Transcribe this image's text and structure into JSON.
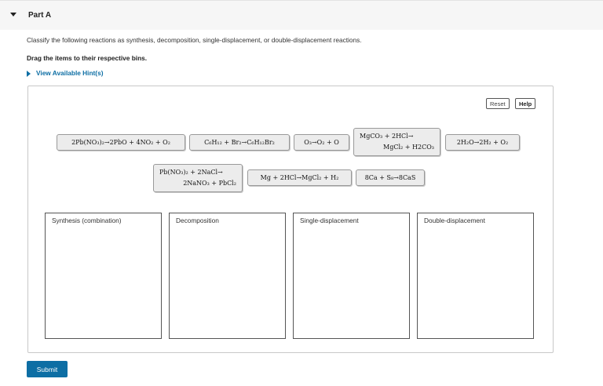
{
  "part": {
    "title": "Part A"
  },
  "instructions": {
    "text": "Classify the following reactions as synthesis, decomposition, single-displacement, or double-displacement reactions.",
    "drag_text": "Drag the items to their respective bins."
  },
  "hint": {
    "label": "View Available Hint(s)"
  },
  "toolbar": {
    "reset_label": "Reset",
    "help_label": "Help"
  },
  "items": [
    {
      "text": "2Pb(NO₃)₂→2PbO + 4NO₂ + O₂"
    },
    {
      "text": "C₆H₁₂ + Br₂→C₆H₁₂Br₂"
    },
    {
      "text": "O₃→O₂ + O"
    },
    {
      "line1": "MgCO₃ + 2HCl→",
      "line2": "MgCl₂ + H2CO₃"
    },
    {
      "text": "2H₂O→2H₂ + O₂"
    },
    {
      "line1": "Pb(NO₃)₂ + 2NaCl→",
      "line2": "2NaNO₃ + PbCl₂"
    },
    {
      "text": "Mg + 2HCl→MgCl₂ + H₂"
    },
    {
      "text": "8Ca + S₈→8CaS"
    }
  ],
  "bins": [
    {
      "label": "Synthesis (combination)"
    },
    {
      "label": "Decomposition"
    },
    {
      "label": "Single-displacement"
    },
    {
      "label": "Double-displacement"
    }
  ],
  "submit": {
    "label": "Submit"
  },
  "colors": {
    "accent": "#0d6ea4",
    "chip_bg": "#ececec",
    "header_bg": "#f6f6f6"
  }
}
